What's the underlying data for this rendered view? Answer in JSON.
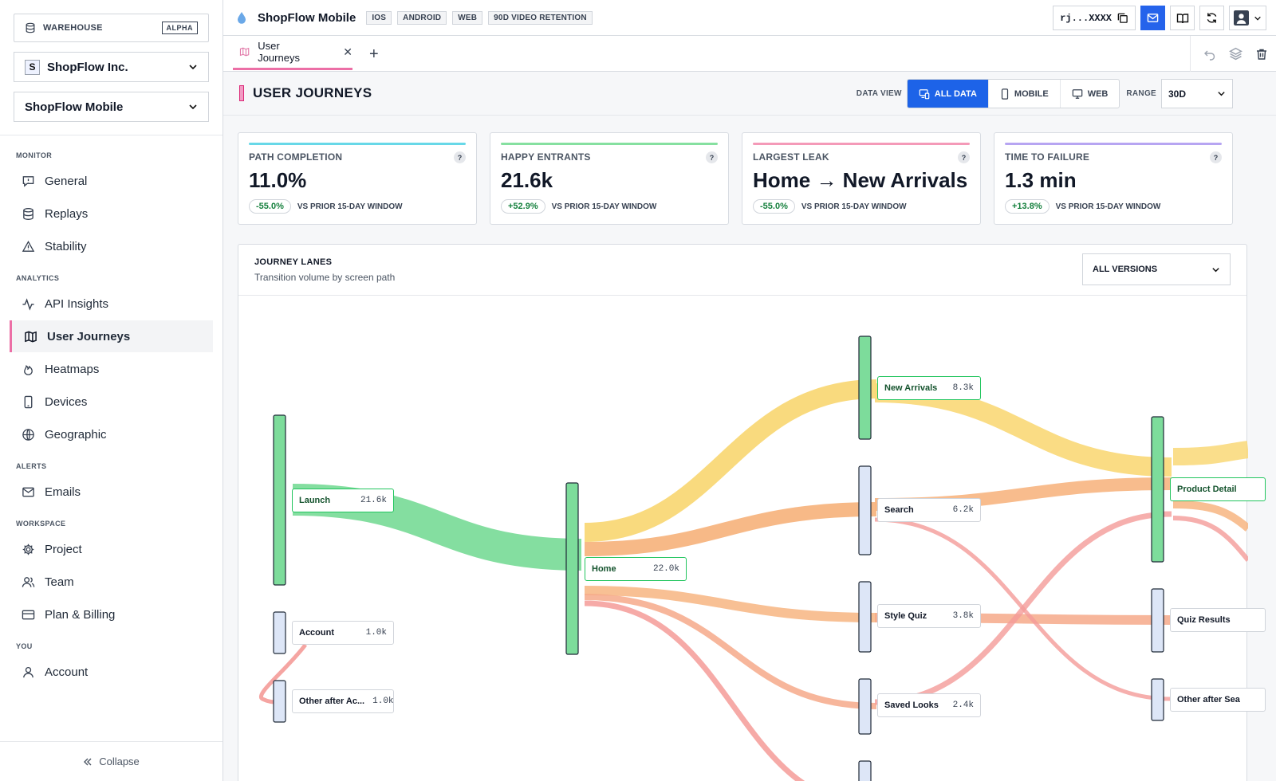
{
  "sidebar": {
    "warehouse_label": "WAREHOUSE",
    "warehouse_badge": "ALPHA",
    "org_initial": "S",
    "org_name": "ShopFlow Inc.",
    "project_name": "ShopFlow Mobile",
    "sections": {
      "monitor": "MONITOR",
      "analytics": "ANALYTICS",
      "alerts": "ALERTS",
      "workspace": "WORKSPACE",
      "you": "YOU"
    },
    "items": {
      "general": "General",
      "replays": "Replays",
      "stability": "Stability",
      "api_insights": "API Insights",
      "user_journeys": "User Journeys",
      "heatmaps": "Heatmaps",
      "devices": "Devices",
      "geographic": "Geographic",
      "emails": "Emails",
      "project": "Project",
      "team": "Team",
      "plan_billing": "Plan & Billing",
      "account": "Account"
    },
    "collapse": "Collapse"
  },
  "topbar": {
    "title": "ShopFlow Mobile",
    "tags": [
      "IOS",
      "ANDROID",
      "WEB",
      "90D VIDEO RETENTION"
    ],
    "api_key": "rj...XXXX"
  },
  "tabs": {
    "active_tab": "User Journeys",
    "close": "✕",
    "add": "+"
  },
  "header": {
    "title": "USER JOURNEYS",
    "data_view_label": "DATA VIEW",
    "views": [
      "ALL DATA",
      "MOBILE",
      "WEB"
    ],
    "range_label": "RANGE",
    "range_value": "30D"
  },
  "kpis": [
    {
      "label": "PATH COMPLETION",
      "value": "11.0%",
      "delta": "-55.0%",
      "note": "VS PRIOR 15-DAY WINDOW",
      "color": "#67d8e8"
    },
    {
      "label": "HAPPY ENTRANTS",
      "value": "21.6k",
      "delta": "+52.9%",
      "note": "VS PRIOR 15-DAY WINDOW",
      "color": "#86e0a0"
    },
    {
      "label": "LARGEST LEAK",
      "value": "Home → New Arrivals",
      "delta": "-55.0%",
      "note": "VS PRIOR 15-DAY WINDOW",
      "color": "#f49ab8"
    },
    {
      "label": "TIME TO FAILURE",
      "value": "1.3 min",
      "delta": "+13.8%",
      "note": "VS PRIOR 15-DAY WINDOW",
      "color": "#b7a5f2"
    }
  ],
  "kpi_help": "?",
  "panel": {
    "title": "JOURNEY LANES",
    "subtitle": "Transition volume by screen path",
    "version_select": "ALL VERSIONS"
  },
  "nodes": {
    "launch": {
      "name": "Launch",
      "count": "21.6k"
    },
    "account": {
      "name": "Account",
      "count": "1.0k"
    },
    "other_account": {
      "name": "Other after Ac...",
      "count": "1.0k"
    },
    "home": {
      "name": "Home",
      "count": "22.0k"
    },
    "new_arrivals": {
      "name": "New Arrivals",
      "count": "8.3k"
    },
    "search": {
      "name": "Search",
      "count": "6.2k"
    },
    "style_quiz": {
      "name": "Style Quiz",
      "count": "3.8k"
    },
    "saved_looks": {
      "name": "Saved Looks",
      "count": "2.4k"
    },
    "product_detail": {
      "name": "Product Detail",
      "count": ""
    },
    "quiz_results": {
      "name": "Quiz Results",
      "count": ""
    },
    "other_search": {
      "name": "Other after Sea",
      "count": ""
    }
  },
  "colors": {
    "accent": "#ec6fa6",
    "primary": "#1d63e8",
    "flow_green": "#7ddc9b",
    "flow_yellow": "#f9d877",
    "flow_orange": "#f7b581",
    "flow_salmon": "#f6a989",
    "flow_red": "#f49b98",
    "node_hot": "#7ddc9b",
    "node_cold": "#dde6f7"
  }
}
